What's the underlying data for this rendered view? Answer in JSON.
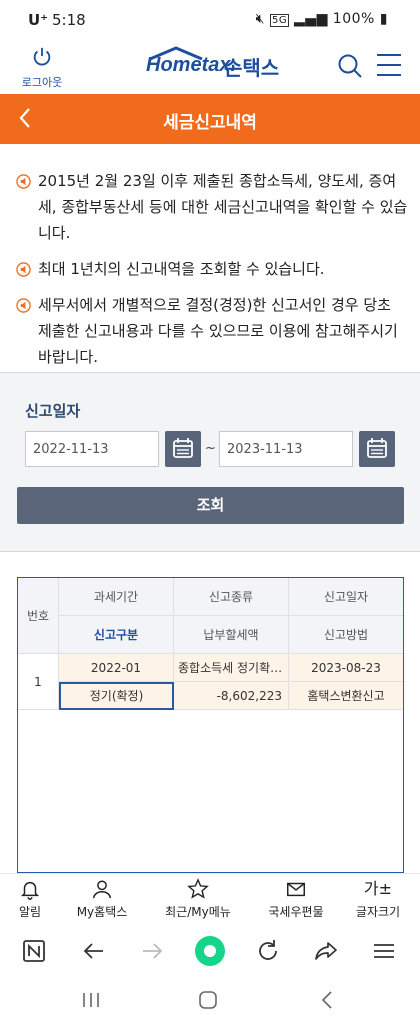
{
  "status_bar": {
    "carrier": "U⁺",
    "time": "5:18",
    "network": "5G",
    "battery": "100%"
  },
  "header": {
    "logout_label": "로그아웃",
    "logo_text": "Hometax.",
    "logo_korean": "손택스"
  },
  "titlebar": {
    "title": "세금신고내역"
  },
  "notices": [
    "2015년 2월 23일 이후 제출된 종합소득세, 양도세, 증여세, 종합부동산세 등에 대한 세금신고내역을 확인할 수 있습니다.",
    "최대 1년치의 신고내역을 조회할 수 있습니다.",
    "세무서에서 개별적으로 결정(경정)한 신고서인 경우 당초 제출한 신고내용과 다를 수 있으므로 이용에 참고해주시기 바랍니다."
  ],
  "search": {
    "label": "신고일자",
    "start_date": "2022-11-13",
    "end_date": "2023-11-13",
    "separator": "~",
    "query_button": "조회"
  },
  "table": {
    "headers_row1": [
      "번호",
      "과세기간",
      "신고종류",
      "신고일자"
    ],
    "headers_row2": [
      "신고구분",
      "납부할세액",
      "신고방법"
    ],
    "rows": [
      {
        "no": "1",
        "period": "2022-01",
        "type": "종합소득세 정기확정신고",
        "date": "2023-08-23",
        "category": "정기(확정)",
        "amount": "-8,602,223",
        "method": "홈택스변환신고"
      }
    ]
  },
  "bottom_nav": [
    {
      "label": "알림",
      "icon": "bell-icon"
    },
    {
      "label": "My홈택스",
      "icon": "person-icon"
    },
    {
      "label": "최근/My메뉴",
      "icon": "star-icon"
    },
    {
      "label": "국세우편물",
      "icon": "mail-icon"
    },
    {
      "label": "글자크기",
      "icon": "text-size-icon"
    }
  ],
  "text_size_glyph": "가±",
  "colors": {
    "accent": "#f06b1b",
    "brand": "#1d4ea0",
    "button": "#5b6579"
  }
}
